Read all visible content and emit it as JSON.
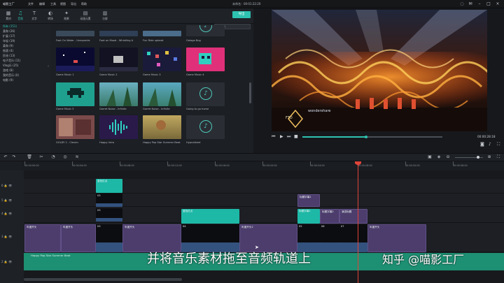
{
  "app": {
    "logo_text": "喵影工厂",
    "project_title": "未命名：00:01:22:20"
  },
  "menu": [
    "文件",
    "编辑",
    "工具",
    "视图",
    "导出",
    "帮助"
  ],
  "toolbar": {
    "tabs": [
      {
        "icon": "▦",
        "label": "素材"
      },
      {
        "icon": "♫",
        "label": "音频"
      },
      {
        "icon": "T",
        "label": "文字"
      },
      {
        "icon": "◐",
        "label": "转场"
      },
      {
        "icon": "✦",
        "label": "效果"
      },
      {
        "icon": "▤",
        "label": "动画元素"
      },
      {
        "icon": "▥",
        "label": "分屏"
      }
    ],
    "export_label": "导出"
  },
  "sidebar": {
    "categories": [
      {
        "label": "所有 (151)",
        "selected": true
      },
      {
        "label": "柔和 (26)"
      },
      {
        "label": "扩展 (17)"
      },
      {
        "label": "年轻 (19)"
      },
      {
        "label": "柔和 (9)"
      },
      {
        "label": "摇滚 (4)"
      },
      {
        "label": "民谣 (13)"
      },
      {
        "label": "电子音乐 (11)"
      },
      {
        "label": "Vlog乐 (25)"
      },
      {
        "label": "游戏 (8)"
      },
      {
        "label": "我的音乐 (0)"
      },
      {
        "label": "电影 (9)"
      }
    ]
  },
  "library": {
    "search_placeholder": "搜索",
    "items": [
      {
        "label": "Foot On Water - Unexpecte",
        "type": "video",
        "color": "#3a4a5a"
      },
      {
        "label": "Foot on Mood - Whistling A",
        "type": "video",
        "color": "#2f3f55"
      },
      {
        "label": "Fun Ride upbeat",
        "type": "video",
        "color": "#3b4656"
      },
      {
        "label": "Galaga Bug",
        "type": "audio"
      },
      {
        "label": "Game Music 1",
        "type": "video",
        "color": "#0a0a30"
      },
      {
        "label": "Game Music 2",
        "type": "video",
        "color": "#121222"
      },
      {
        "label": "Game Music 3",
        "type": "video",
        "color": "#1a1a3a"
      },
      {
        "label": "Game Music 4",
        "type": "video",
        "color": "#2b2040"
      },
      {
        "label": "Game Music 5",
        "type": "video",
        "color": "#1fa08f"
      },
      {
        "label": "Garret Noise - Infinite",
        "type": "video",
        "color": "#4a8a9a"
      },
      {
        "label": "Garret Noise - Infinite",
        "type": "video",
        "color": "#3a7a8a"
      },
      {
        "label": "Going to go home",
        "type": "audio"
      },
      {
        "label": "GOLDY 2 - Cleven",
        "type": "video",
        "color": "#7a4a4a"
      },
      {
        "label": "Happy Intro",
        "type": "video",
        "color": "#2a1a4a"
      },
      {
        "label": "Happy Pop Star Summer Beat",
        "type": "video",
        "color": "#8a7a3a"
      },
      {
        "label": "Hypnotized",
        "type": "audio"
      }
    ]
  },
  "preview": {
    "timecode": "00:00:28:18",
    "logo_text": "FTD",
    "brand_text": "wondershare"
  },
  "timeline": {
    "ruler_labels": [
      "00:00:00:00",
      "00:00:04:00",
      "00:00:08:00",
      "00:00:12:00",
      "00:00:16:00",
      "00:00:20:00",
      "00:00:24:00",
      "00:00:28:00",
      "00:00:32:00",
      "00:00:36:00"
    ],
    "track_labels": [
      "6",
      "5",
      "4",
      "3",
      "2",
      "1",
      "1"
    ],
    "clips": {
      "top_teal_label": "蓝色红点",
      "title_a": "标题字幕1",
      "title_b": "标题字幕2",
      "title_c": "演讲标题",
      "purple_main": "年度开头",
      "purple_a": "年度开头",
      "purple_b": "年度开头2",
      "num_03": "03",
      "num_04": "04",
      "num_05": "05",
      "num_06": "06",
      "num_07": "07",
      "teal_mid": "蓝色红点"
    },
    "audio_label": "Happy Pop Star Summer Beat"
  },
  "overlay": {
    "subtitle": "并将音乐素材拖至音频轨道上",
    "watermark": "知乎 @喵影工厂"
  },
  "colors": {
    "accent": "#2ec2b0",
    "playhead": "#e0443a",
    "clip_purple": "#4c3d6c",
    "clip_teal": "#1eb8a7"
  }
}
